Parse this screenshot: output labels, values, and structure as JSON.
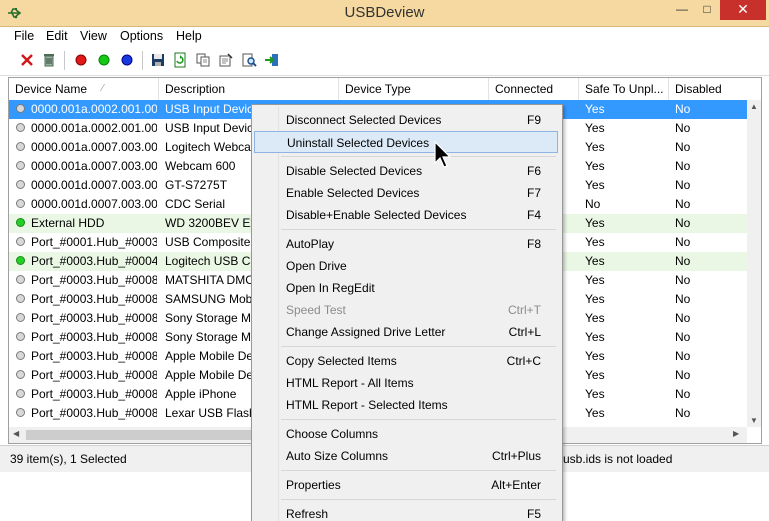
{
  "window": {
    "title": "USBDeview"
  },
  "menu": [
    "File",
    "Edit",
    "View",
    "Options",
    "Help"
  ],
  "toolbar_icons": [
    "delete-icon",
    "recycle-icon",
    "red-dot-icon",
    "green-dot-icon",
    "blue-dot-icon",
    "save-icon",
    "refresh-icon",
    "copy-icon",
    "properties-icon",
    "find-icon",
    "exit-icon"
  ],
  "columns": [
    "Device Name",
    "Description",
    "Device Type",
    "Connected",
    "Safe To Unpl...",
    "Disabled"
  ],
  "rows": [
    {
      "name": "0000.001a.0002.001.00...",
      "description": "USB Input Device",
      "safe": "Yes",
      "disabled": "No",
      "status": "gray",
      "selected": true
    },
    {
      "name": "0000.001a.0002.001.00...",
      "description": "USB Input Device",
      "safe": "Yes",
      "disabled": "No",
      "status": "gray"
    },
    {
      "name": "0000.001a.0007.003.00...",
      "description": "Logitech Webcam",
      "safe": "Yes",
      "disabled": "No",
      "status": "gray"
    },
    {
      "name": "0000.001a.0007.003.00...",
      "description": "Webcam 600",
      "safe": "Yes",
      "disabled": "No",
      "status": "gray"
    },
    {
      "name": "0000.001d.0007.003.00...",
      "description": "GT-S7275T",
      "safe": "Yes",
      "disabled": "No",
      "status": "gray"
    },
    {
      "name": "0000.001d.0007.003.00...",
      "description": "CDC Serial",
      "safe": "No",
      "disabled": "No",
      "status": "gray"
    },
    {
      "name": "External HDD",
      "description": "WD 3200BEV Ext",
      "safe": "Yes",
      "disabled": "No",
      "status": "green"
    },
    {
      "name": "Port_#0001.Hub_#0003",
      "description": "USB Composite",
      "safe": "Yes",
      "disabled": "No",
      "status": "gray"
    },
    {
      "name": "Port_#0003.Hub_#0004",
      "description": "Logitech USB Ca",
      "safe": "Yes",
      "disabled": "No",
      "status": "green"
    },
    {
      "name": "Port_#0003.Hub_#0008",
      "description": "MATSHITA DMC",
      "safe": "Yes",
      "disabled": "No",
      "status": "gray"
    },
    {
      "name": "Port_#0003.Hub_#0008",
      "description": "SAMSUNG Mob",
      "safe": "Yes",
      "disabled": "No",
      "status": "gray"
    },
    {
      "name": "Port_#0003.Hub_#0008",
      "description": "Sony Storage Me",
      "safe": "Yes",
      "disabled": "No",
      "status": "gray"
    },
    {
      "name": "Port_#0003.Hub_#0008",
      "description": "Sony Storage Me",
      "safe": "Yes",
      "disabled": "No",
      "status": "gray"
    },
    {
      "name": "Port_#0003.Hub_#0008",
      "description": "Apple Mobile De",
      "safe": "Yes",
      "disabled": "No",
      "status": "gray"
    },
    {
      "name": "Port_#0003.Hub_#0008",
      "description": "Apple Mobile De",
      "safe": "Yes",
      "disabled": "No",
      "status": "gray"
    },
    {
      "name": "Port_#0003.Hub_#0008",
      "description": "Apple iPhone",
      "safe": "Yes",
      "disabled": "No",
      "status": "gray"
    },
    {
      "name": "Port_#0003.Hub_#0008",
      "description": "Lexar USB Flash",
      "safe": "Yes",
      "disabled": "No",
      "status": "gray"
    }
  ],
  "context_menu": [
    {
      "label": "Disconnect Selected Devices",
      "key": "F9"
    },
    {
      "label": "Uninstall Selected Devices",
      "key": "",
      "highlighted": true
    },
    {
      "separator": true
    },
    {
      "label": "Disable Selected Devices",
      "key": "F6"
    },
    {
      "label": "Enable Selected Devices",
      "key": "F7"
    },
    {
      "label": "Disable+Enable Selected Devices",
      "key": "F4"
    },
    {
      "separator": true
    },
    {
      "label": "AutoPlay",
      "key": "F8"
    },
    {
      "label": "Open Drive",
      "key": ""
    },
    {
      "label": "Open In RegEdit",
      "key": ""
    },
    {
      "label": "Speed Test",
      "key": "Ctrl+T",
      "disabled": true
    },
    {
      "label": "Change Assigned Drive Letter",
      "key": "Ctrl+L"
    },
    {
      "separator": true
    },
    {
      "label": "Copy Selected Items",
      "key": "Ctrl+C"
    },
    {
      "label": "HTML Report - All Items",
      "key": ""
    },
    {
      "label": "HTML Report - Selected Items",
      "key": ""
    },
    {
      "separator": true
    },
    {
      "label": "Choose Columns",
      "key": ""
    },
    {
      "label": "Auto Size Columns",
      "key": "Ctrl+Plus"
    },
    {
      "separator": true
    },
    {
      "label": "Properties",
      "key": "Alt+Enter"
    },
    {
      "separator": true
    },
    {
      "label": "Refresh",
      "key": "F5"
    }
  ],
  "status": {
    "count": "39 item(s), 1 Selected",
    "message": "usb.ids is not loaded"
  },
  "colors": {
    "titlebar": "#f5d9a0",
    "selection": "#3399ff",
    "connected_row": "#eaf7e5",
    "close_button": "#c7302b"
  }
}
